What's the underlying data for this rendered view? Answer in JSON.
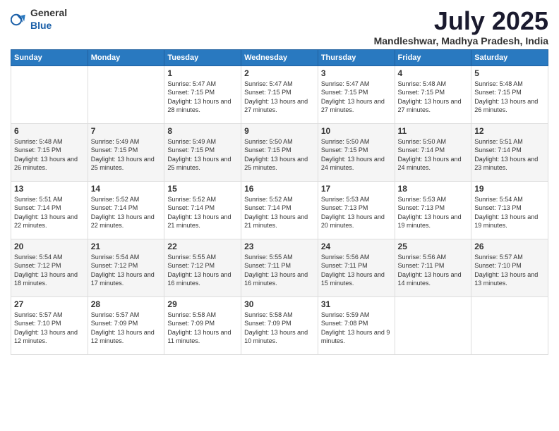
{
  "logo": {
    "general": "General",
    "blue": "Blue"
  },
  "header": {
    "month": "July 2025",
    "location": "Mandleshwar, Madhya Pradesh, India"
  },
  "weekdays": [
    "Sunday",
    "Monday",
    "Tuesday",
    "Wednesday",
    "Thursday",
    "Friday",
    "Saturday"
  ],
  "weeks": [
    [
      {
        "day": "",
        "info": ""
      },
      {
        "day": "",
        "info": ""
      },
      {
        "day": "1",
        "info": "Sunrise: 5:47 AM\nSunset: 7:15 PM\nDaylight: 13 hours and 28 minutes."
      },
      {
        "day": "2",
        "info": "Sunrise: 5:47 AM\nSunset: 7:15 PM\nDaylight: 13 hours and 27 minutes."
      },
      {
        "day": "3",
        "info": "Sunrise: 5:47 AM\nSunset: 7:15 PM\nDaylight: 13 hours and 27 minutes."
      },
      {
        "day": "4",
        "info": "Sunrise: 5:48 AM\nSunset: 7:15 PM\nDaylight: 13 hours and 27 minutes."
      },
      {
        "day": "5",
        "info": "Sunrise: 5:48 AM\nSunset: 7:15 PM\nDaylight: 13 hours and 26 minutes."
      }
    ],
    [
      {
        "day": "6",
        "info": "Sunrise: 5:48 AM\nSunset: 7:15 PM\nDaylight: 13 hours and 26 minutes."
      },
      {
        "day": "7",
        "info": "Sunrise: 5:49 AM\nSunset: 7:15 PM\nDaylight: 13 hours and 25 minutes."
      },
      {
        "day": "8",
        "info": "Sunrise: 5:49 AM\nSunset: 7:15 PM\nDaylight: 13 hours and 25 minutes."
      },
      {
        "day": "9",
        "info": "Sunrise: 5:50 AM\nSunset: 7:15 PM\nDaylight: 13 hours and 25 minutes."
      },
      {
        "day": "10",
        "info": "Sunrise: 5:50 AM\nSunset: 7:15 PM\nDaylight: 13 hours and 24 minutes."
      },
      {
        "day": "11",
        "info": "Sunrise: 5:50 AM\nSunset: 7:14 PM\nDaylight: 13 hours and 24 minutes."
      },
      {
        "day": "12",
        "info": "Sunrise: 5:51 AM\nSunset: 7:14 PM\nDaylight: 13 hours and 23 minutes."
      }
    ],
    [
      {
        "day": "13",
        "info": "Sunrise: 5:51 AM\nSunset: 7:14 PM\nDaylight: 13 hours and 22 minutes."
      },
      {
        "day": "14",
        "info": "Sunrise: 5:52 AM\nSunset: 7:14 PM\nDaylight: 13 hours and 22 minutes."
      },
      {
        "day": "15",
        "info": "Sunrise: 5:52 AM\nSunset: 7:14 PM\nDaylight: 13 hours and 21 minutes."
      },
      {
        "day": "16",
        "info": "Sunrise: 5:52 AM\nSunset: 7:14 PM\nDaylight: 13 hours and 21 minutes."
      },
      {
        "day": "17",
        "info": "Sunrise: 5:53 AM\nSunset: 7:13 PM\nDaylight: 13 hours and 20 minutes."
      },
      {
        "day": "18",
        "info": "Sunrise: 5:53 AM\nSunset: 7:13 PM\nDaylight: 13 hours and 19 minutes."
      },
      {
        "day": "19",
        "info": "Sunrise: 5:54 AM\nSunset: 7:13 PM\nDaylight: 13 hours and 19 minutes."
      }
    ],
    [
      {
        "day": "20",
        "info": "Sunrise: 5:54 AM\nSunset: 7:12 PM\nDaylight: 13 hours and 18 minutes."
      },
      {
        "day": "21",
        "info": "Sunrise: 5:54 AM\nSunset: 7:12 PM\nDaylight: 13 hours and 17 minutes."
      },
      {
        "day": "22",
        "info": "Sunrise: 5:55 AM\nSunset: 7:12 PM\nDaylight: 13 hours and 16 minutes."
      },
      {
        "day": "23",
        "info": "Sunrise: 5:55 AM\nSunset: 7:11 PM\nDaylight: 13 hours and 16 minutes."
      },
      {
        "day": "24",
        "info": "Sunrise: 5:56 AM\nSunset: 7:11 PM\nDaylight: 13 hours and 15 minutes."
      },
      {
        "day": "25",
        "info": "Sunrise: 5:56 AM\nSunset: 7:11 PM\nDaylight: 13 hours and 14 minutes."
      },
      {
        "day": "26",
        "info": "Sunrise: 5:57 AM\nSunset: 7:10 PM\nDaylight: 13 hours and 13 minutes."
      }
    ],
    [
      {
        "day": "27",
        "info": "Sunrise: 5:57 AM\nSunset: 7:10 PM\nDaylight: 13 hours and 12 minutes."
      },
      {
        "day": "28",
        "info": "Sunrise: 5:57 AM\nSunset: 7:09 PM\nDaylight: 13 hours and 12 minutes."
      },
      {
        "day": "29",
        "info": "Sunrise: 5:58 AM\nSunset: 7:09 PM\nDaylight: 13 hours and 11 minutes."
      },
      {
        "day": "30",
        "info": "Sunrise: 5:58 AM\nSunset: 7:09 PM\nDaylight: 13 hours and 10 minutes."
      },
      {
        "day": "31",
        "info": "Sunrise: 5:59 AM\nSunset: 7:08 PM\nDaylight: 13 hours and 9 minutes."
      },
      {
        "day": "",
        "info": ""
      },
      {
        "day": "",
        "info": ""
      }
    ]
  ]
}
